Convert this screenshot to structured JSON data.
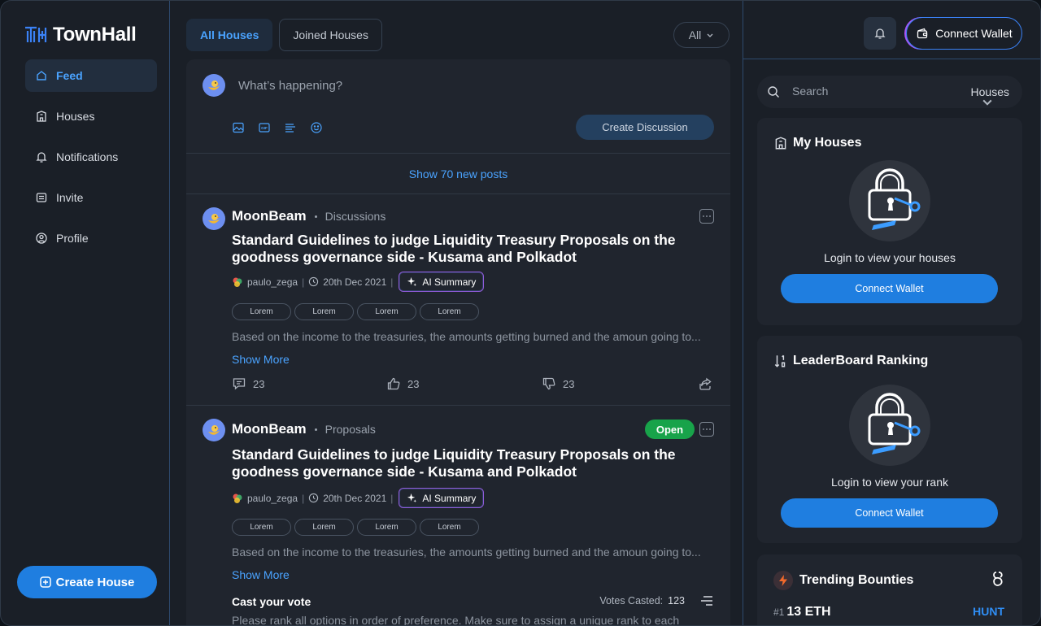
{
  "app": {
    "name": "TownHall"
  },
  "sidebar": {
    "items": [
      {
        "label": "Feed",
        "icon": "home-icon",
        "active": true
      },
      {
        "label": "Houses",
        "icon": "building-icon",
        "active": false
      },
      {
        "label": "Notifications",
        "icon": "bell-icon",
        "active": false
      },
      {
        "label": "Invite",
        "icon": "invite-icon",
        "active": false
      },
      {
        "label": "Profile",
        "icon": "user-circle-icon",
        "active": false
      }
    ],
    "create_house_label": "Create House"
  },
  "feed_tabs": {
    "items": [
      {
        "label": "All Houses",
        "active": true
      },
      {
        "label": "Joined Houses",
        "active": false
      }
    ],
    "filter_value": "All"
  },
  "composer": {
    "placeholder": "What’s happening?",
    "create_label": "Create Discussion",
    "tools": [
      "image-icon",
      "gif-icon",
      "poll-icon",
      "emoji-icon"
    ]
  },
  "new_posts_label": "Show 70 new posts",
  "posts": [
    {
      "author": "MoonBeam",
      "category": "Discussions",
      "title": "Standard Guidelines to judge Liquidity Treasury Proposals on the goodness governance side - Kusama and Polkadot",
      "user": "paulo_zega",
      "date": "20th Dec 2021",
      "ai_label": "AI Summary",
      "tags": [
        "Lorem",
        "Lorem",
        "Lorem",
        "Lorem"
      ],
      "excerpt": "Based on the income to the treasuries, the amounts getting burned and the amoun going to...",
      "show_more": "Show More",
      "comments": "23",
      "likes": "23",
      "dislikes": "23"
    },
    {
      "author": "MoonBeam",
      "category": "Proposals",
      "status": "Open",
      "title": "Standard Guidelines to judge Liquidity Treasury Proposals on the goodness governance side - Kusama and Polkadot",
      "user": "paulo_zega",
      "date": "20th Dec 2021",
      "ai_label": "AI Summary",
      "tags": [
        "Lorem",
        "Lorem",
        "Lorem",
        "Lorem"
      ],
      "excerpt": "Based on the income to the treasuries, the amounts getting burned and the amoun going to...",
      "show_more": "Show More",
      "vote_title": "Cast your vote",
      "votes_label": "Votes Casted:",
      "votes_count": "123",
      "vote_desc": "Please rank all options in order of preference. Make sure to assign a unique rank to each"
    }
  ],
  "right": {
    "connect_wallet_label": "Connect Wallet",
    "search": {
      "placeholder": "Search",
      "scope": "Houses"
    },
    "my_houses": {
      "title": "My Houses",
      "message": "Login to view your houses",
      "button": "Connect Wallet"
    },
    "leaderboard": {
      "title": "LeaderBoard Ranking",
      "message": "Login to view your rank",
      "button": "Connect Wallet"
    },
    "bounties": {
      "title": "Trending Bounties",
      "rank": "#1",
      "amount": "13 ETH",
      "tag": "HUNT"
    }
  },
  "colors": {
    "accent": "#1f7ee0",
    "link": "#4aa3ff",
    "open": "#18a34a",
    "panel": "#20252e",
    "bg": "#1a1f27"
  }
}
